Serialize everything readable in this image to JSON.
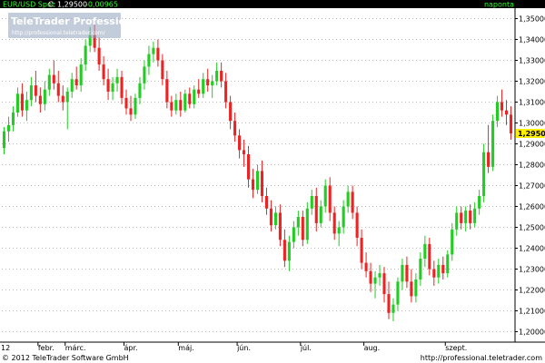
{
  "header": {
    "instrument": "EUR/USD Spot",
    "close_label": "C:",
    "close_value": "1,29500",
    "change_value": "-0,00965",
    "period": "naponta"
  },
  "logo": {
    "brand": "TeleTrader Professional",
    "url": "http://professional.teletrader.com/"
  },
  "footer": {
    "copyright": "© 2012 TeleTrader Software GmbH",
    "url": "http://professional.teletrader.com"
  },
  "colors": {
    "up": "#22cc22",
    "down": "#ee2222",
    "header_bg": "#000000",
    "instrument_text": "#33ff33",
    "change_text": "#33ff33",
    "period_text": "#33ff33",
    "last_price_bg": "#ffee00",
    "grid": "#bbbbbb",
    "axis": "#000000"
  },
  "chart_data": {
    "type": "candlestick",
    "title": "EUR/USD Spot",
    "year_label": "12",
    "x_months": [
      "febr.",
      "márc.",
      "ápr.",
      "máj.",
      "jún.",
      "júl.",
      "aug.",
      "szept."
    ],
    "ylim": [
      1.195,
      1.355
    ],
    "y_ticks": [
      "1,20000",
      "1,21000",
      "1,22000",
      "1,23000",
      "1,24000",
      "1,25000",
      "1,26000",
      "1,27000",
      "1,28000",
      "1,29000",
      "1,30000",
      "1,31000",
      "1,32000",
      "1,33000",
      "1,34000",
      "1,35000"
    ],
    "last_price": 1.295,
    "last_price_label": "1,29500",
    "grid": true,
    "candles": [
      {
        "o": 1.288,
        "h": 1.298,
        "l": 1.285,
        "c": 1.296
      },
      {
        "o": 1.296,
        "h": 1.303,
        "l": 1.291,
        "c": 1.299
      },
      {
        "o": 1.299,
        "h": 1.308,
        "l": 1.296,
        "c": 1.305
      },
      {
        "o": 1.305,
        "h": 1.317,
        "l": 1.303,
        "c": 1.314
      },
      {
        "o": 1.314,
        "h": 1.319,
        "l": 1.303,
        "c": 1.306
      },
      {
        "o": 1.306,
        "h": 1.315,
        "l": 1.301,
        "c": 1.311
      },
      {
        "o": 1.311,
        "h": 1.322,
        "l": 1.308,
        "c": 1.318
      },
      {
        "o": 1.318,
        "h": 1.325,
        "l": 1.31,
        "c": 1.313
      },
      {
        "o": 1.313,
        "h": 1.317,
        "l": 1.305,
        "c": 1.309
      },
      {
        "o": 1.309,
        "h": 1.32,
        "l": 1.306,
        "c": 1.316
      },
      {
        "o": 1.316,
        "h": 1.326,
        "l": 1.313,
        "c": 1.323
      },
      {
        "o": 1.323,
        "h": 1.33,
        "l": 1.316,
        "c": 1.319
      },
      {
        "o": 1.319,
        "h": 1.325,
        "l": 1.31,
        "c": 1.313
      },
      {
        "o": 1.313,
        "h": 1.318,
        "l": 1.306,
        "c": 1.31
      },
      {
        "o": 1.31,
        "h": 1.317,
        "l": 1.297,
        "c": 1.315
      },
      {
        "o": 1.315,
        "h": 1.324,
        "l": 1.312,
        "c": 1.321
      },
      {
        "o": 1.321,
        "h": 1.327,
        "l": 1.316,
        "c": 1.318
      },
      {
        "o": 1.318,
        "h": 1.331,
        "l": 1.315,
        "c": 1.328
      },
      {
        "o": 1.328,
        "h": 1.34,
        "l": 1.325,
        "c": 1.337
      },
      {
        "o": 1.337,
        "h": 1.346,
        "l": 1.334,
        "c": 1.342
      },
      {
        "o": 1.342,
        "h": 1.347,
        "l": 1.334,
        "c": 1.336
      },
      {
        "o": 1.336,
        "h": 1.341,
        "l": 1.325,
        "c": 1.328
      },
      {
        "o": 1.328,
        "h": 1.332,
        "l": 1.318,
        "c": 1.321
      },
      {
        "o": 1.321,
        "h": 1.326,
        "l": 1.311,
        "c": 1.315
      },
      {
        "o": 1.315,
        "h": 1.322,
        "l": 1.311,
        "c": 1.319
      },
      {
        "o": 1.319,
        "h": 1.326,
        "l": 1.315,
        "c": 1.322
      },
      {
        "o": 1.322,
        "h": 1.325,
        "l": 1.309,
        "c": 1.312
      },
      {
        "o": 1.312,
        "h": 1.316,
        "l": 1.304,
        "c": 1.307
      },
      {
        "o": 1.307,
        "h": 1.313,
        "l": 1.301,
        "c": 1.304
      },
      {
        "o": 1.304,
        "h": 1.314,
        "l": 1.302,
        "c": 1.312
      },
      {
        "o": 1.312,
        "h": 1.322,
        "l": 1.309,
        "c": 1.319
      },
      {
        "o": 1.319,
        "h": 1.33,
        "l": 1.316,
        "c": 1.327
      },
      {
        "o": 1.327,
        "h": 1.337,
        "l": 1.323,
        "c": 1.333
      },
      {
        "o": 1.333,
        "h": 1.339,
        "l": 1.329,
        "c": 1.336
      },
      {
        "o": 1.336,
        "h": 1.34,
        "l": 1.327,
        "c": 1.33
      },
      {
        "o": 1.33,
        "h": 1.333,
        "l": 1.318,
        "c": 1.321
      },
      {
        "o": 1.321,
        "h": 1.325,
        "l": 1.307,
        "c": 1.31
      },
      {
        "o": 1.31,
        "h": 1.313,
        "l": 1.303,
        "c": 1.306
      },
      {
        "o": 1.306,
        "h": 1.314,
        "l": 1.304,
        "c": 1.311
      },
      {
        "o": 1.311,
        "h": 1.315,
        "l": 1.303,
        "c": 1.306
      },
      {
        "o": 1.306,
        "h": 1.316,
        "l": 1.305,
        "c": 1.314
      },
      {
        "o": 1.314,
        "h": 1.317,
        "l": 1.307,
        "c": 1.309
      },
      {
        "o": 1.309,
        "h": 1.318,
        "l": 1.307,
        "c": 1.316
      },
      {
        "o": 1.316,
        "h": 1.321,
        "l": 1.312,
        "c": 1.314
      },
      {
        "o": 1.314,
        "h": 1.324,
        "l": 1.312,
        "c": 1.321
      },
      {
        "o": 1.321,
        "h": 1.326,
        "l": 1.315,
        "c": 1.318
      },
      {
        "o": 1.318,
        "h": 1.323,
        "l": 1.312,
        "c": 1.32
      },
      {
        "o": 1.32,
        "h": 1.329,
        "l": 1.318,
        "c": 1.325
      },
      {
        "o": 1.325,
        "h": 1.329,
        "l": 1.317,
        "c": 1.32
      },
      {
        "o": 1.32,
        "h": 1.324,
        "l": 1.307,
        "c": 1.31
      },
      {
        "o": 1.31,
        "h": 1.313,
        "l": 1.297,
        "c": 1.301
      },
      {
        "o": 1.301,
        "h": 1.305,
        "l": 1.291,
        "c": 1.294
      },
      {
        "o": 1.294,
        "h": 1.297,
        "l": 1.283,
        "c": 1.287
      },
      {
        "o": 1.287,
        "h": 1.292,
        "l": 1.279,
        "c": 1.285
      },
      {
        "o": 1.285,
        "h": 1.289,
        "l": 1.269,
        "c": 1.273
      },
      {
        "o": 1.273,
        "h": 1.278,
        "l": 1.264,
        "c": 1.268
      },
      {
        "o": 1.268,
        "h": 1.28,
        "l": 1.266,
        "c": 1.277
      },
      {
        "o": 1.277,
        "h": 1.282,
        "l": 1.262,
        "c": 1.265
      },
      {
        "o": 1.265,
        "h": 1.269,
        "l": 1.256,
        "c": 1.259
      },
      {
        "o": 1.259,
        "h": 1.263,
        "l": 1.248,
        "c": 1.251
      },
      {
        "o": 1.251,
        "h": 1.26,
        "l": 1.249,
        "c": 1.257
      },
      {
        "o": 1.257,
        "h": 1.261,
        "l": 1.241,
        "c": 1.244
      },
      {
        "o": 1.244,
        "h": 1.249,
        "l": 1.231,
        "c": 1.234
      },
      {
        "o": 1.234,
        "h": 1.246,
        "l": 1.229,
        "c": 1.243
      },
      {
        "o": 1.243,
        "h": 1.253,
        "l": 1.24,
        "c": 1.25
      },
      {
        "o": 1.25,
        "h": 1.258,
        "l": 1.246,
        "c": 1.255
      },
      {
        "o": 1.255,
        "h": 1.258,
        "l": 1.241,
        "c": 1.244
      },
      {
        "o": 1.244,
        "h": 1.262,
        "l": 1.242,
        "c": 1.259
      },
      {
        "o": 1.259,
        "h": 1.268,
        "l": 1.256,
        "c": 1.265
      },
      {
        "o": 1.265,
        "h": 1.269,
        "l": 1.248,
        "c": 1.252
      },
      {
        "o": 1.252,
        "h": 1.263,
        "l": 1.25,
        "c": 1.26
      },
      {
        "o": 1.26,
        "h": 1.273,
        "l": 1.257,
        "c": 1.27
      },
      {
        "o": 1.27,
        "h": 1.274,
        "l": 1.253,
        "c": 1.257
      },
      {
        "o": 1.257,
        "h": 1.26,
        "l": 1.244,
        "c": 1.247
      },
      {
        "o": 1.247,
        "h": 1.253,
        "l": 1.241,
        "c": 1.25
      },
      {
        "o": 1.25,
        "h": 1.263,
        "l": 1.247,
        "c": 1.26
      },
      {
        "o": 1.26,
        "h": 1.27,
        "l": 1.257,
        "c": 1.267
      },
      {
        "o": 1.267,
        "h": 1.27,
        "l": 1.254,
        "c": 1.257
      },
      {
        "o": 1.257,
        "h": 1.26,
        "l": 1.241,
        "c": 1.245
      },
      {
        "o": 1.245,
        "h": 1.249,
        "l": 1.23,
        "c": 1.233
      },
      {
        "o": 1.233,
        "h": 1.238,
        "l": 1.226,
        "c": 1.229
      },
      {
        "o": 1.229,
        "h": 1.233,
        "l": 1.219,
        "c": 1.223
      },
      {
        "o": 1.223,
        "h": 1.229,
        "l": 1.216,
        "c": 1.226
      },
      {
        "o": 1.226,
        "h": 1.232,
        "l": 1.222,
        "c": 1.228
      },
      {
        "o": 1.228,
        "h": 1.231,
        "l": 1.214,
        "c": 1.218
      },
      {
        "o": 1.218,
        "h": 1.224,
        "l": 1.206,
        "c": 1.209
      },
      {
        "o": 1.209,
        "h": 1.216,
        "l": 1.205,
        "c": 1.213
      },
      {
        "o": 1.213,
        "h": 1.226,
        "l": 1.21,
        "c": 1.224
      },
      {
        "o": 1.224,
        "h": 1.235,
        "l": 1.22,
        "c": 1.232
      },
      {
        "o": 1.232,
        "h": 1.236,
        "l": 1.221,
        "c": 1.224
      },
      {
        "o": 1.224,
        "h": 1.23,
        "l": 1.214,
        "c": 1.217
      },
      {
        "o": 1.217,
        "h": 1.228,
        "l": 1.214,
        "c": 1.225
      },
      {
        "o": 1.225,
        "h": 1.238,
        "l": 1.222,
        "c": 1.235
      },
      {
        "o": 1.235,
        "h": 1.246,
        "l": 1.231,
        "c": 1.242
      },
      {
        "o": 1.242,
        "h": 1.245,
        "l": 1.227,
        "c": 1.23
      },
      {
        "o": 1.23,
        "h": 1.234,
        "l": 1.222,
        "c": 1.226
      },
      {
        "o": 1.226,
        "h": 1.235,
        "l": 1.223,
        "c": 1.232
      },
      {
        "o": 1.232,
        "h": 1.236,
        "l": 1.225,
        "c": 1.228
      },
      {
        "o": 1.228,
        "h": 1.239,
        "l": 1.226,
        "c": 1.237
      },
      {
        "o": 1.237,
        "h": 1.252,
        "l": 1.234,
        "c": 1.249
      },
      {
        "o": 1.249,
        "h": 1.26,
        "l": 1.246,
        "c": 1.257
      },
      {
        "o": 1.257,
        "h": 1.26,
        "l": 1.249,
        "c": 1.252
      },
      {
        "o": 1.252,
        "h": 1.26,
        "l": 1.248,
        "c": 1.258
      },
      {
        "o": 1.258,
        "h": 1.261,
        "l": 1.249,
        "c": 1.252
      },
      {
        "o": 1.252,
        "h": 1.262,
        "l": 1.25,
        "c": 1.259
      },
      {
        "o": 1.259,
        "h": 1.268,
        "l": 1.256,
        "c": 1.265
      },
      {
        "o": 1.265,
        "h": 1.29,
        "l": 1.262,
        "c": 1.286
      },
      {
        "o": 1.286,
        "h": 1.299,
        "l": 1.276,
        "c": 1.279
      },
      {
        "o": 1.279,
        "h": 1.304,
        "l": 1.277,
        "c": 1.301
      },
      {
        "o": 1.301,
        "h": 1.313,
        "l": 1.298,
        "c": 1.31
      },
      {
        "o": 1.31,
        "h": 1.316,
        "l": 1.303,
        "c": 1.306
      },
      {
        "o": 1.306,
        "h": 1.311,
        "l": 1.299,
        "c": 1.304
      },
      {
        "o": 1.304,
        "h": 1.308,
        "l": 1.292,
        "c": 1.295
      }
    ]
  }
}
